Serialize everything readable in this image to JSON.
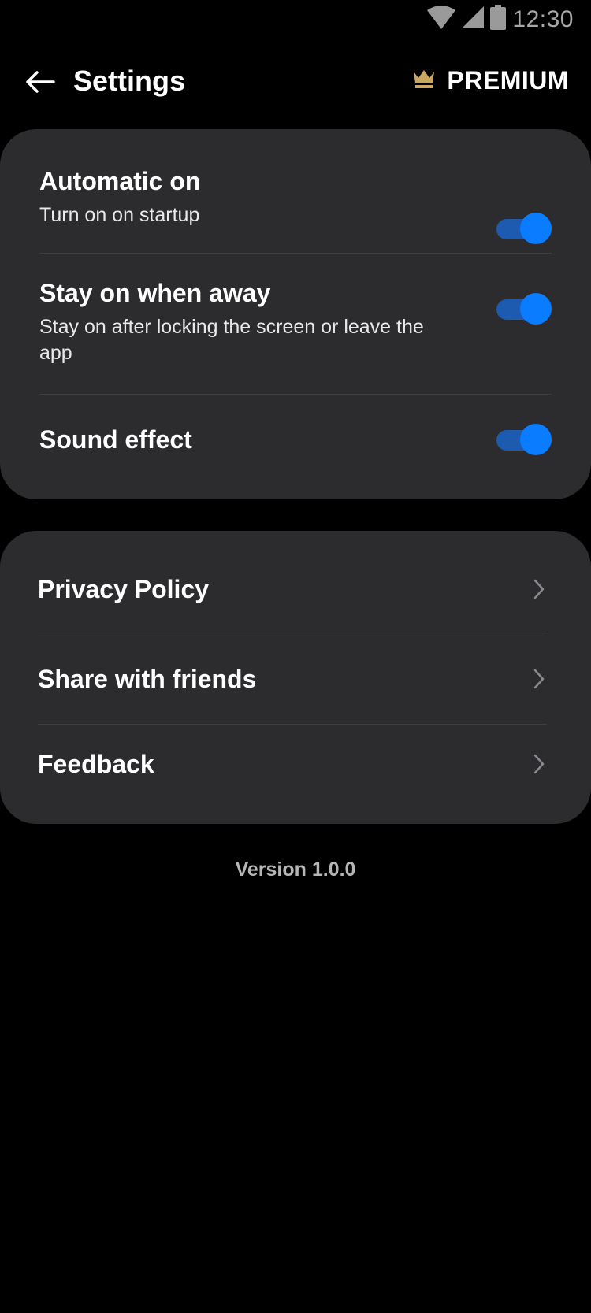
{
  "status_bar": {
    "time": "12:30",
    "icons": [
      "wifi-icon",
      "cellular-signal-icon",
      "battery-icon"
    ]
  },
  "header": {
    "title": "Settings",
    "back_icon": "arrow-left-icon",
    "premium_label": "PREMIUM",
    "premium_icon": "crown-icon",
    "premium_color": "#c9a961"
  },
  "toggles": [
    {
      "title": "Automatic on",
      "subtitle": "Turn on on startup",
      "enabled": true
    },
    {
      "title": "Stay on when away",
      "subtitle": "Stay on after locking the screen or leave the app",
      "enabled": true
    },
    {
      "title": "Sound effect",
      "subtitle": "",
      "enabled": true
    }
  ],
  "links": [
    {
      "label": "Privacy Policy",
      "icon": "chevron-right-icon"
    },
    {
      "label": "Share with friends",
      "icon": "chevron-right-icon"
    },
    {
      "label": "Feedback",
      "icon": "chevron-right-icon"
    }
  ],
  "footer": {
    "version": "Version 1.0.0"
  },
  "colors": {
    "background": "#000000",
    "card": "#2c2c2e",
    "toggle_track": "#1c5bb0",
    "toggle_thumb": "#0a7cff",
    "divider": "#3f3f42"
  }
}
